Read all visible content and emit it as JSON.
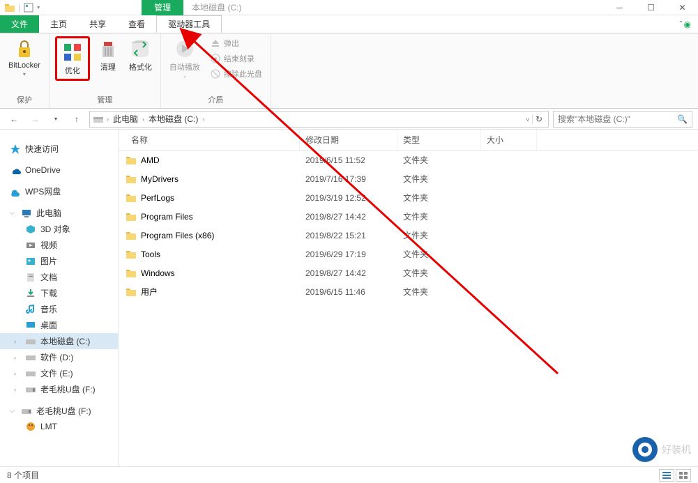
{
  "title": "本地磁盘 (C:)",
  "manage_tab": "管理",
  "menus": {
    "file": "文件",
    "home": "主页",
    "share": "共享",
    "view": "查看",
    "drivetools": "驱动器工具"
  },
  "ribbon": {
    "protect": {
      "bitlocker": "BitLocker",
      "label": "保护"
    },
    "manage": {
      "optimize": "优化",
      "cleanup": "清理",
      "format": "格式化",
      "label": "管理"
    },
    "media": {
      "autoplay": "自动播放",
      "eject": "弹出",
      "finishburn": "结束刻录",
      "erasedisc": "擦除此光盘",
      "label": "介质"
    }
  },
  "breadcrumb": {
    "thispc": "此电脑",
    "drive": "本地磁盘 (C:)"
  },
  "search_placeholder": "搜索\"本地磁盘 (C:)\"",
  "nav": {
    "quickaccess": "快速访问",
    "onedrive": "OneDrive",
    "wps": "WPS网盘",
    "thispc": "此电脑",
    "obj3d": "3D 对象",
    "videos": "视频",
    "pictures": "图片",
    "documents": "文档",
    "downloads": "下载",
    "music": "音乐",
    "desktop": "桌面",
    "cdrive": "本地磁盘 (C:)",
    "ddrive": "软件 (D:)",
    "edrive": "文件 (E:)",
    "fdrive": "老毛桃U盘 (F:)",
    "fdrive2": "老毛桃U盘 (F:)",
    "lmt": "LMT"
  },
  "cols": {
    "name": "名称",
    "date": "修改日期",
    "type": "类型",
    "size": "大小"
  },
  "files": [
    {
      "name": "AMD",
      "date": "2019/6/15 11:52",
      "type": "文件夹"
    },
    {
      "name": "MyDrivers",
      "date": "2019/7/16 17:39",
      "type": "文件夹"
    },
    {
      "name": "PerfLogs",
      "date": "2019/3/19 12:52",
      "type": "文件夹"
    },
    {
      "name": "Program Files",
      "date": "2019/8/27 14:42",
      "type": "文件夹"
    },
    {
      "name": "Program Files (x86)",
      "date": "2019/8/22 15:21",
      "type": "文件夹"
    },
    {
      "name": "Tools",
      "date": "2019/6/29 17:19",
      "type": "文件夹"
    },
    {
      "name": "Windows",
      "date": "2019/8/27 14:42",
      "type": "文件夹"
    },
    {
      "name": "用户",
      "date": "2019/6/15 11:46",
      "type": "文件夹"
    }
  ],
  "status": "8 个项目",
  "watermark": "好装机"
}
